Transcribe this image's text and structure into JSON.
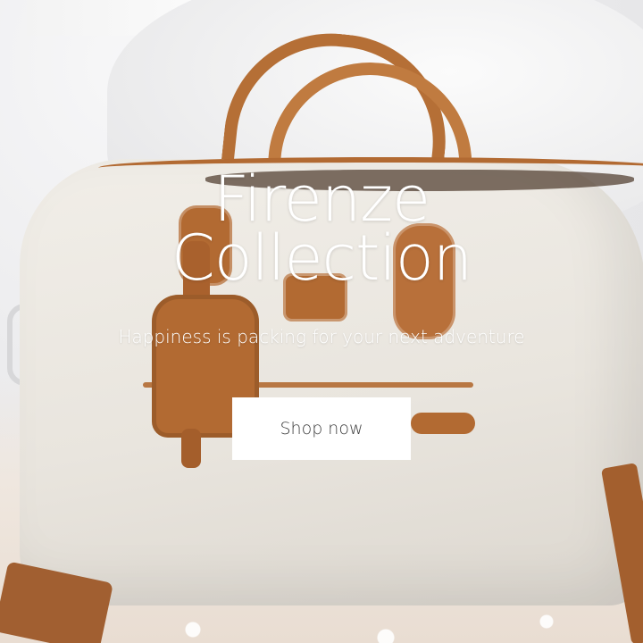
{
  "hero": {
    "title_line1": "Firenze",
    "title_line2": "Collection",
    "subtitle": "Happiness is packing for your next adventure",
    "cta_label": "Shop now"
  },
  "colors": {
    "text": "#ffffff",
    "button_bg": "#ffffff",
    "button_text": "#3b3b3b",
    "leather": "#b26a32",
    "canvas": "#ece8e1"
  }
}
